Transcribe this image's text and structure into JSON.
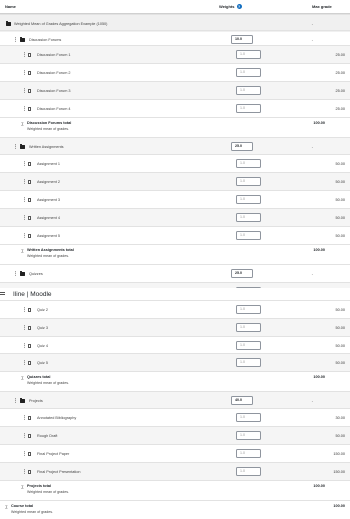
{
  "header": {
    "name": "Name",
    "weights": "Weights",
    "help_icon": "?",
    "max_grade": "Max grade"
  },
  "course_category": {
    "label": "Weighted Mean of Grades Aggregation Example (1050)",
    "max": "-"
  },
  "overlay": {
    "title": "Iline | Moodle",
    "icon": "grid-icon"
  },
  "discussion": {
    "label": "Discussion Forums",
    "weight": "10.0",
    "max": "-",
    "items": [
      {
        "label": "Discussion Forum 1",
        "weight": "1.0",
        "max": "25.00"
      },
      {
        "label": "Discussion Forum 2",
        "weight": "1.0",
        "max": "25.00"
      },
      {
        "label": "Discussion Forum 3",
        "weight": "1.0",
        "max": "25.00"
      },
      {
        "label": "Discussion Forum 4",
        "weight": "1.0",
        "max": "25.00"
      }
    ],
    "total": {
      "sigma": "∑",
      "name": "Discussion Forums total",
      "desc": "Weighted mean of grades.",
      "max": "100.00"
    }
  },
  "written": {
    "label": "Written Assignments",
    "weight": "25.0",
    "max": "-",
    "items": [
      {
        "label": "Assignment 1",
        "weight": "1.0",
        "max": "50.00"
      },
      {
        "label": "Assignment 2",
        "weight": "1.0",
        "max": "50.00"
      },
      {
        "label": "Assignment 3",
        "weight": "1.0",
        "max": "50.00"
      },
      {
        "label": "Assignment 4",
        "weight": "1.0",
        "max": "50.00"
      },
      {
        "label": "Assignment 5",
        "weight": "1.0",
        "max": "50.00"
      }
    ],
    "total": {
      "sigma": "∑",
      "name": "Written Assignments total",
      "desc": "Weighted mean of grades.",
      "max": "100.00"
    }
  },
  "quizzes": {
    "label": "Quizzes",
    "weight": "25.0",
    "max": "-",
    "items": [
      {
        "label": "Quiz 1",
        "weight": "1.0",
        "max": "50.00"
      },
      {
        "label": "Quiz 2",
        "weight": "1.0",
        "max": "50.00"
      },
      {
        "label": "Quiz 3",
        "weight": "1.0",
        "max": "50.00"
      },
      {
        "label": "Quiz 4",
        "weight": "1.0",
        "max": "50.00"
      },
      {
        "label": "Quiz 5",
        "weight": "1.0",
        "max": "50.00"
      }
    ],
    "total": {
      "sigma": "∑",
      "name": "Quizzes total",
      "desc": "Weighted mean of grades.",
      "max": "100.00"
    }
  },
  "projects": {
    "label": "Projects",
    "weight": "40.0",
    "max": "-",
    "items": [
      {
        "label": "Annotated Bibliography",
        "weight": "1.0",
        "max": "30.00"
      },
      {
        "label": "Rough Draft",
        "weight": "1.0",
        "max": "50.00"
      },
      {
        "label": "Final Project Paper",
        "weight": "1.0",
        "max": "150.00"
      },
      {
        "label": "Final Project Presentation",
        "weight": "1.0",
        "max": "150.00"
      }
    ],
    "total": {
      "sigma": "∑",
      "name": "Projects total",
      "desc": "Weighted mean of grades.",
      "max": "100.00"
    }
  },
  "course_total": {
    "sigma": "∑",
    "name": "Course total",
    "desc": "Weighted mean of grades.",
    "max": "100.00"
  }
}
